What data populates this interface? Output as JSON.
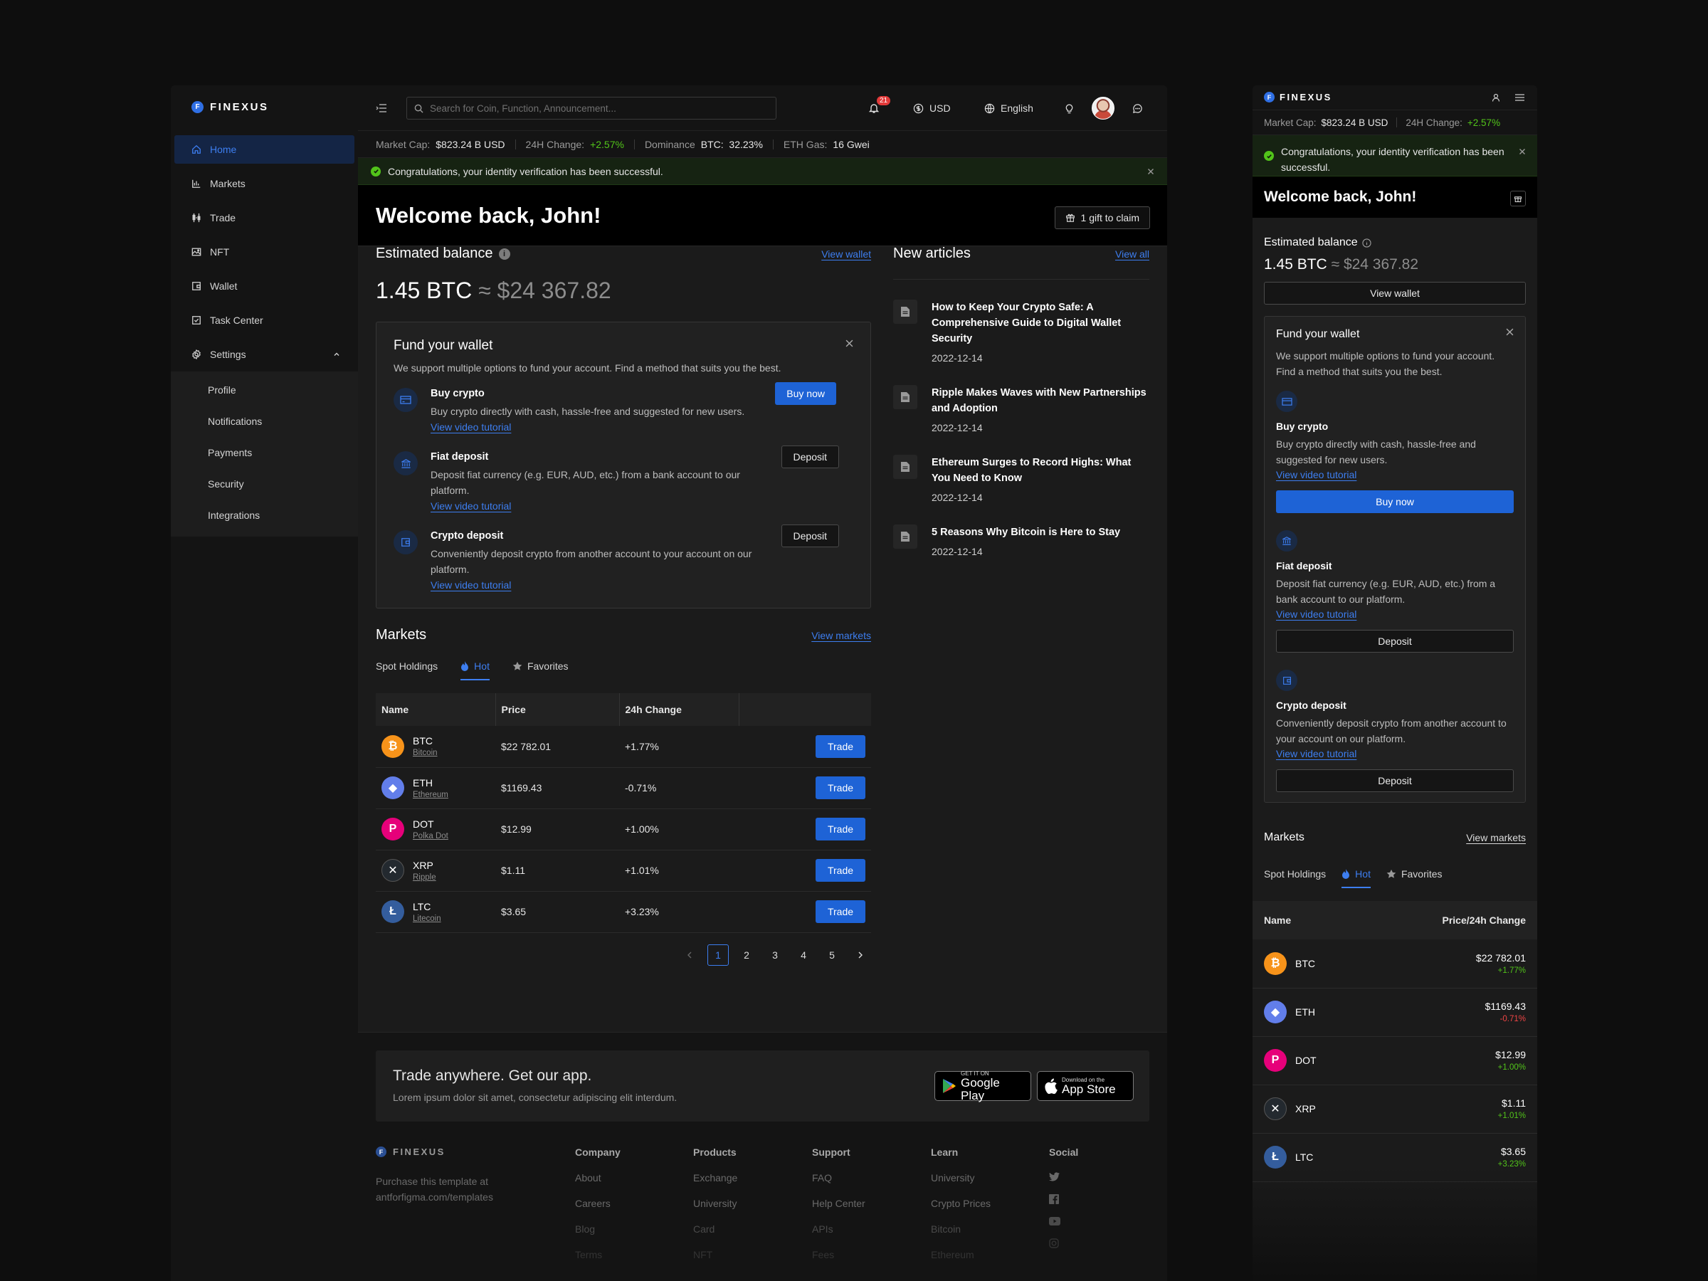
{
  "brand": {
    "name": "FINEXUS",
    "mark": "F"
  },
  "sidebar": {
    "items": [
      {
        "label": "Home",
        "icon": "home-icon"
      },
      {
        "label": "Markets",
        "icon": "bar-chart-icon"
      },
      {
        "label": "Trade",
        "icon": "candlestick-icon"
      },
      {
        "label": "NFT",
        "icon": "image-icon"
      },
      {
        "label": "Wallet",
        "icon": "wallet-icon"
      },
      {
        "label": "Task Center",
        "icon": "checkbox-icon"
      },
      {
        "label": "Settings",
        "icon": "gear-icon"
      }
    ],
    "settings_sub": [
      "Profile",
      "Notifications",
      "Payments",
      "Security",
      "Integrations"
    ]
  },
  "topbar": {
    "search_placeholder": "Search for Coin, Function, Announcement...",
    "notifications_count": "21",
    "currency": "USD",
    "language": "English"
  },
  "ticker": {
    "market_cap_label": "Market Cap:",
    "market_cap_value": "$823.24 B USD",
    "change_label": "24H Change:",
    "change_value": "+2.57%",
    "dominance_label": "Dominance",
    "dominance_value": "BTC:  32.23%",
    "gas_label": "ETH Gas:",
    "gas_value": "16 Gwei"
  },
  "alert": {
    "text": "Congratulations, your identity verification has been successful."
  },
  "welcome": {
    "title": "Welcome back, John!",
    "gift_label": "1 gift to claim"
  },
  "balance": {
    "title": "Estimated balance",
    "view_wallet": "View wallet",
    "btc": "1.45 BTC",
    "approx": "≈",
    "usd": "$24 367.82"
  },
  "fund": {
    "title": "Fund your wallet",
    "desc": "We support multiple options to fund your account. Find a method that suits you the best.",
    "options": [
      {
        "title": "Buy crypto",
        "desc": "Buy crypto directly with cash, hassle-free and suggested for new users.",
        "link": "View video tutorial",
        "button": "Buy now"
      },
      {
        "title": "Fiat deposit",
        "desc": "Deposit fiat currency (e.g. EUR, AUD, etc.) from a bank account to our platform.",
        "link": "View video tutorial",
        "button": "Deposit"
      },
      {
        "title": "Crypto deposit",
        "desc": "Conveniently deposit crypto from another account to your account on our platform.",
        "link": "View video tutorial",
        "button": "Deposit"
      }
    ]
  },
  "markets": {
    "title": "Markets",
    "view_link": "View markets",
    "tabs": [
      "Spot Holdings",
      "Hot",
      "Favorites"
    ],
    "columns": [
      "Name",
      "Price",
      "24h Change"
    ],
    "mobile_columns": [
      "Name",
      "Price/24h Change"
    ],
    "trade_label": "Trade",
    "rows": [
      {
        "sym": "BTC",
        "name": "Bitcoin",
        "price": "$22 782.01",
        "change": "+1.77%",
        "color": "#f7931a",
        "glyph": "₿"
      },
      {
        "sym": "ETH",
        "name": "Ethereum",
        "price": "$1169.43",
        "change": "-0.71%",
        "color": "#627eea",
        "glyph": "◆"
      },
      {
        "sym": "DOT",
        "name": "Polka Dot",
        "price": "$12.99",
        "change": "+1.00%",
        "color": "#e6007a",
        "glyph": "P"
      },
      {
        "sym": "XRP",
        "name": "Ripple",
        "price": "$1.11",
        "change": "+1.01%",
        "color": "#23292f",
        "glyph": "✕"
      },
      {
        "sym": "LTC",
        "name": "Litecoin",
        "price": "$3.65",
        "change": "+3.23%",
        "color": "#345d9d",
        "glyph": "Ł"
      }
    ],
    "pages": [
      "1",
      "2",
      "3",
      "4",
      "5"
    ]
  },
  "articles": {
    "title": "New articles",
    "view_all": "View all",
    "items": [
      {
        "title": "How to Keep Your Crypto Safe: A Comprehensive Guide to Digital Wallet Security",
        "date": "2022-12-14"
      },
      {
        "title": "Ripple Makes Waves with New Partnerships and Adoption",
        "date": "2022-12-14"
      },
      {
        "title": "Ethereum Surges to Record Highs: What You Need to Know",
        "date": "2022-12-14"
      },
      {
        "title": "5 Reasons Why Bitcoin is Here to Stay",
        "date": "2022-12-14"
      }
    ]
  },
  "app_promo": {
    "title": "Trade anywhere. Get our app.",
    "desc": "Lorem ipsum dolor sit amet, consectetur adipiscing elit interdum.",
    "google_small": "GET IT ON",
    "google_large": "Google Play",
    "apple_small": "Download on the",
    "apple_large": "App Store"
  },
  "footer": {
    "tagline_1": "Purchase this template at",
    "tagline_2": "antforfigma.com/templates",
    "columns": [
      {
        "title": "Company",
        "items": [
          "About",
          "Careers",
          "Blog",
          "Terms"
        ]
      },
      {
        "title": "Products",
        "items": [
          "Exchange",
          "University",
          "Card",
          "NFT"
        ]
      },
      {
        "title": "Support",
        "items": [
          "FAQ",
          "Help Center",
          "APIs",
          "Fees"
        ]
      },
      {
        "title": "Learn",
        "items": [
          "University",
          "Crypto Prices",
          "Bitcoin",
          "Ethereum"
        ]
      }
    ],
    "social_title": "Social",
    "social_icons": [
      "twitter-icon",
      "facebook-icon",
      "youtube-icon",
      "instagram-icon"
    ]
  },
  "colors": {
    "accent": "#1e63d6",
    "positive": "#52c41a",
    "negative": "#f04545"
  }
}
